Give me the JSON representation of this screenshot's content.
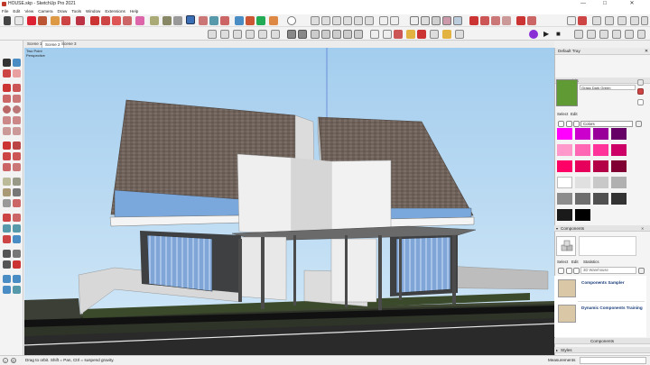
{
  "window": {
    "title": "HOUSE.skp - SketchUp Pro 2021",
    "minimize": "—",
    "maximize": "☐",
    "close": "✕"
  },
  "menu": [
    "File",
    "Edit",
    "View",
    "Camera",
    "Draw",
    "Tools",
    "Window",
    "Extensions",
    "Help"
  ],
  "scenes": [
    "Scene 1",
    "Scene 2",
    "Scene 3"
  ],
  "active_scene": "Scene 2",
  "viewport": {
    "camera_label_1": "Two Point",
    "camera_label_2": "Perspective",
    "colors": {
      "sky": "#a9d2f0",
      "ground": "#3f4a32",
      "roof": "#6f6258",
      "wall": "#eeeeee",
      "glass": "#8fb2d9"
    }
  },
  "status": {
    "hint": "Drag to orbit. Shift = Pan, Ctrl = suspend gravity.",
    "measurements_label": "Measurements",
    "measurements_value": ""
  },
  "tray": {
    "title": "Default Tray",
    "materials": {
      "header": "Materials",
      "current_name": "Grass Dark Green",
      "tab_select": "Select",
      "tab_edit": "Edit",
      "library": "Colors",
      "swatches": [
        "#ff00ff",
        "#cc00cc",
        "#990099",
        "#660066",
        "#ff99cc",
        "#ff66b3",
        "#ff3399",
        "#cc0066",
        "#ff0066",
        "#e6005c",
        "#b30047",
        "#800033",
        "#ffffff",
        "#e0e0e0",
        "#c8c8c8",
        "#b0b0b0",
        "#8c8c8c",
        "#6e6e6e",
        "#505050",
        "#333333",
        "#1a1a1a",
        "#000000"
      ]
    },
    "components": {
      "header": "Components",
      "tab_select": "Select",
      "tab_edit": "Edit",
      "tab_statistics": "Statistics",
      "search_placeholder": "3D Warehouse",
      "items": [
        "Components Sampler",
        "Dynamic Components Training"
      ],
      "footer": "Components"
    },
    "styles": {
      "header": "Styles"
    }
  }
}
